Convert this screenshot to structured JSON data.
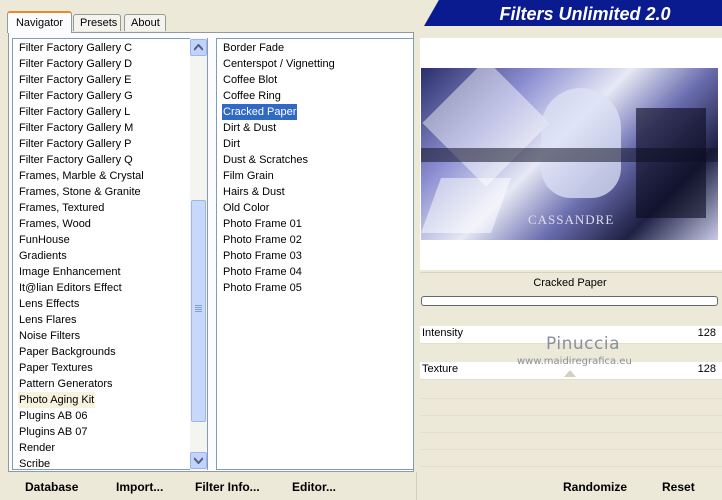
{
  "tabs": [
    "Navigator",
    "Presets",
    "About"
  ],
  "banner_title": "Filters Unlimited 2.0",
  "categories": [
    "Filter Factory Gallery C",
    "Filter Factory Gallery D",
    "Filter Factory Gallery E",
    "Filter Factory Gallery G",
    "Filter Factory Gallery L",
    "Filter Factory Gallery M",
    "Filter Factory Gallery P",
    "Filter Factory Gallery Q",
    "Frames, Marble & Crystal",
    "Frames, Stone & Granite",
    "Frames, Textured",
    "Frames, Wood",
    "FunHouse",
    "Gradients",
    "Image Enhancement",
    "It@lian Editors Effect",
    "Lens Effects",
    "Lens Flares",
    "Noise Filters",
    "Paper Backgrounds",
    "Paper Textures",
    "Pattern Generators",
    "Photo Aging Kit",
    "Plugins AB 06",
    "Plugins AB 07",
    "Render",
    "Scribe"
  ],
  "selected_category": "Photo Aging Kit",
  "filters": [
    "Border Fade",
    "Centerspot / Vignetting",
    "Coffee Blot",
    "Coffee Ring",
    "Cracked Paper",
    "Dirt & Dust",
    "Dirt",
    "Dust & Scratches",
    "Film Grain",
    "Hairs & Dust",
    "Old Color",
    "Photo Frame 01",
    "Photo Frame 02",
    "Photo Frame 03",
    "Photo Frame 04",
    "Photo Frame 05"
  ],
  "selected_filter": "Cracked Paper",
  "preview_signature": "CASSANDRE",
  "filter_name": "Cracked Paper",
  "params": [
    {
      "label": "Intensity",
      "value": "128"
    },
    {
      "label": "Texture",
      "value": "128"
    }
  ],
  "watermark": {
    "name": "Pinuccia",
    "url": "www.maidiregrafica.eu"
  },
  "buttons": {
    "database": "Database",
    "import": "Import...",
    "filter_info": "Filter Info...",
    "editor": "Editor...",
    "randomize": "Randomize",
    "reset": "Reset"
  },
  "colors": {
    "banner": "#0a1a8f",
    "selection": "#316ac5",
    "tab_accent": "#e68b2c"
  }
}
